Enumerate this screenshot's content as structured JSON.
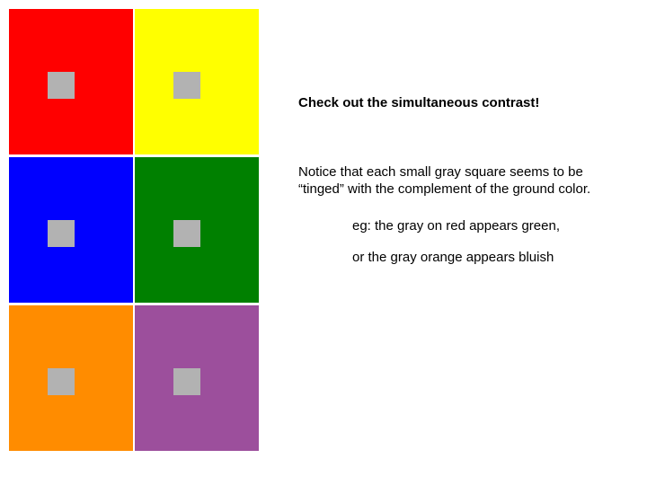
{
  "colors": {
    "gray_chip": "#b2b2b2",
    "swatches": [
      [
        "#ff0000",
        "#ffff00"
      ],
      [
        "#0000ff",
        "#008000"
      ],
      [
        "#ff8c00",
        "#9c4f9c"
      ]
    ]
  },
  "text": {
    "heading": "Check out the simultaneous contrast!",
    "notice": "Notice that each small gray square seems to be “tinged” with the complement of the ground color.",
    "eg1": "eg: the gray on red appears green,",
    "eg2": "or the gray orange appears bluish"
  }
}
